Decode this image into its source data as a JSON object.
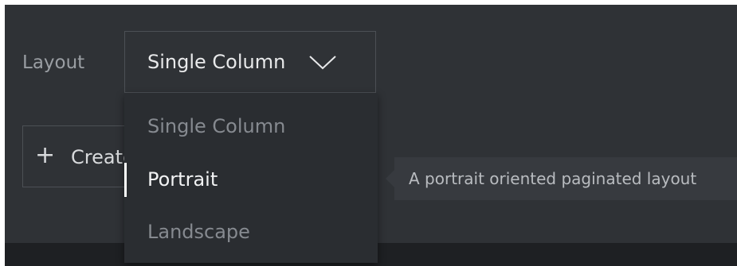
{
  "layout": {
    "label": "Layout",
    "selected_value": "Single Column",
    "options": [
      {
        "label": "Single Column"
      },
      {
        "label": "Portrait"
      },
      {
        "label": "Landscape"
      }
    ],
    "highlighted_option": "Portrait"
  },
  "create_button": {
    "label": "Create"
  },
  "tooltip": {
    "text": "A portrait oriented paginated layout"
  },
  "icons": {
    "dropdown_chevron": "chevron-down-icon",
    "create_plus": "plus-icon"
  },
  "colors": {
    "background": "#2f3236",
    "menu_background": "#2a2d31",
    "tooltip_background": "#373a3f",
    "selected_indicator": "#ffffff"
  }
}
